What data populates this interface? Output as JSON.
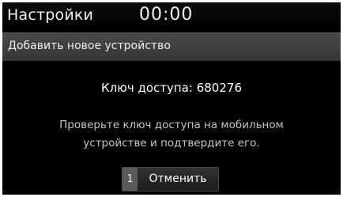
{
  "statusbar": {
    "title": "Настройки",
    "time": "00:00"
  },
  "dialog": {
    "title": "Добавить новое устройство",
    "passkey": "Ключ доступа: 680276",
    "message_line1": "Проверьте ключ доступа на мобильном",
    "message_line2": "устройстве и подтвердите его.",
    "cancel_button": {
      "index": "1",
      "label": "Отменить"
    }
  },
  "colors": {
    "background": "#000000",
    "header": "#3e3e3e",
    "text": "#ffffff",
    "secondary_text": "#c6c6c6",
    "button_index": "#5a5a5a"
  }
}
